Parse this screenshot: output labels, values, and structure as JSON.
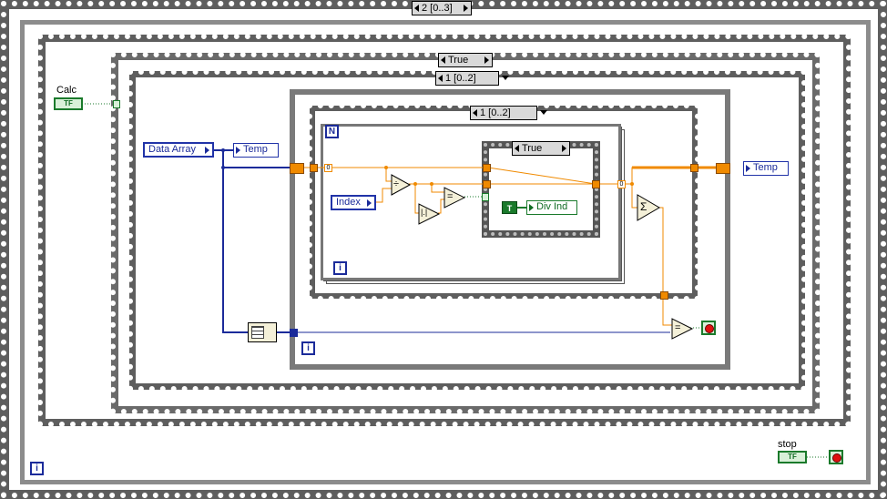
{
  "outer_sequence": {
    "selector": "2 [0..3]"
  },
  "while_loop_outer": {
    "iteration_icon": "i"
  },
  "case_true": {
    "selector": "True"
  },
  "inner_sequence": {
    "selector": "1 [0..2]"
  },
  "inner_loop": {
    "iteration_icon": "i"
  },
  "innermost_sequence": {
    "selector": "1 [0..2]"
  },
  "for_loop": {
    "count_icon": "N",
    "iteration_icon": "i"
  },
  "inner_case": {
    "selector": "True"
  },
  "controls": {
    "calc_label": "Calc",
    "calc_value": "TF",
    "stop_label": "stop",
    "stop_value": "TF",
    "data_array": "Data Array",
    "index": "Index"
  },
  "locals": {
    "temp_out": "Temp",
    "temp_in": "Temp",
    "div_ind": "Div Ind",
    "true_const": "T"
  },
  "functions": {
    "divide": "÷",
    "abs": "|.|",
    "equal": "=",
    "sum": "Σ",
    "equal_final": "=",
    "zero_const": "0",
    "zero_const_b": "0"
  },
  "colors": {
    "wire_orange": "#f08a00",
    "wire_blue": "#1b2b9a",
    "wire_green": "#1a7a2b"
  }
}
